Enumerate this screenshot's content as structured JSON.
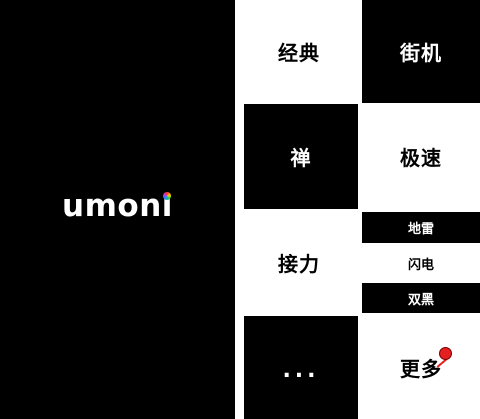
{
  "splash": {
    "logo_main": "umon",
    "logo_last": "ı"
  },
  "menu": {
    "classic": "经典",
    "arcade": "街机",
    "zen": "禅",
    "rush": "极速",
    "relay": "接力",
    "bomb": "地雷",
    "lightning": "闪电",
    "double_black": "双黑",
    "ellipsis": "...",
    "more": "更多"
  },
  "colors": {
    "tile_black": "#000000",
    "tile_white": "#ffffff",
    "badge": "#e42020"
  }
}
